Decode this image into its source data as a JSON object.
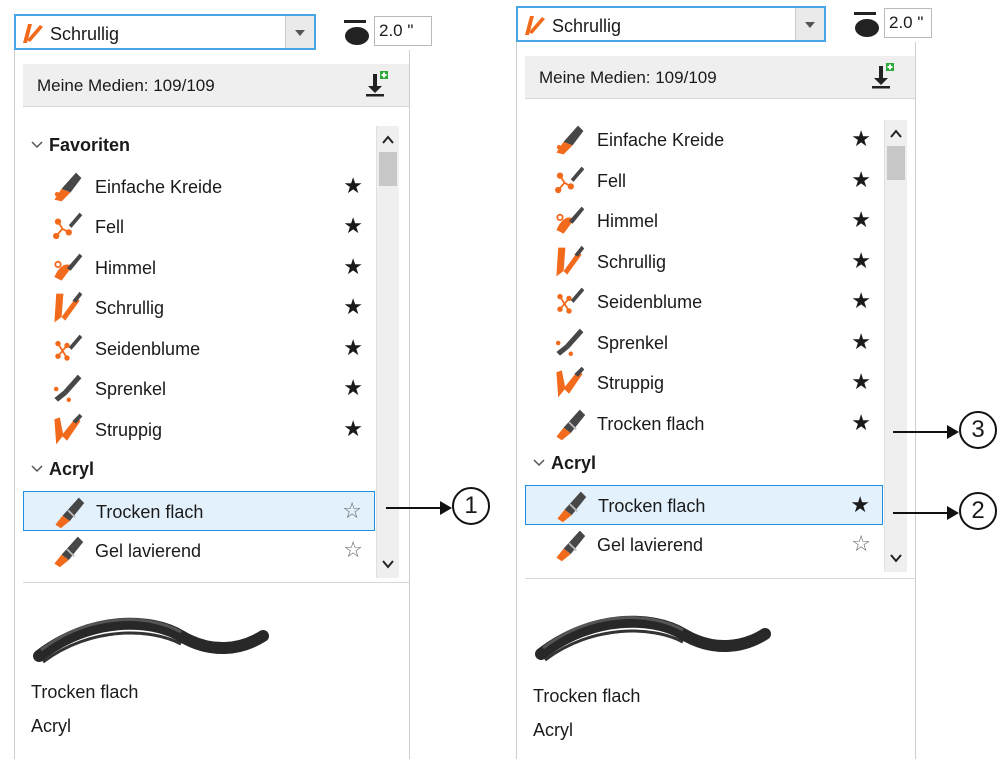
{
  "colors": {
    "accent_orange": "#f26a1b",
    "icon_dark": "#474747",
    "selection_border": "#1f8ee5",
    "selection_fill": "#e3f1fd"
  },
  "left_panel": {
    "preset": "Schrullig",
    "size_value": "2.0 \"",
    "media_header": "Meine Medien: 109/109",
    "sections": [
      {
        "type": "category",
        "label": "Favoriten"
      },
      {
        "type": "item",
        "label": "Einfache Kreide",
        "icon": "chalk-icon",
        "favorite": true
      },
      {
        "type": "item",
        "label": "Fell",
        "icon": "fur-icon",
        "favorite": true
      },
      {
        "type": "item",
        "label": "Himmel",
        "icon": "sky-icon",
        "favorite": true
      },
      {
        "type": "item",
        "label": "Schrullig",
        "icon": "quirky-icon",
        "favorite": true
      },
      {
        "type": "item",
        "label": "Seidenblume",
        "icon": "silkflower-icon",
        "favorite": true
      },
      {
        "type": "item",
        "label": "Sprenkel",
        "icon": "sprinkle-icon",
        "favorite": true
      },
      {
        "type": "item",
        "label": "Struppig",
        "icon": "shaggy-icon",
        "favorite": true
      },
      {
        "type": "category",
        "label": "Acryl"
      },
      {
        "type": "item",
        "label": "Trocken flach",
        "icon": "flat-brush-icon",
        "favorite": false,
        "selected": true
      },
      {
        "type": "item",
        "label": "Gel lavierend",
        "icon": "flat-brush-icon",
        "favorite": false
      }
    ],
    "preview_name": "Trocken flach",
    "preview_category": "Acryl",
    "callout": "1"
  },
  "right_panel": {
    "preset": "Schrullig",
    "size_value": "2.0 \"",
    "media_header": "Meine Medien: 109/109",
    "sections": [
      {
        "type": "item",
        "label": "Einfache Kreide",
        "icon": "chalk-icon",
        "favorite": true
      },
      {
        "type": "item",
        "label": "Fell",
        "icon": "fur-icon",
        "favorite": true
      },
      {
        "type": "item",
        "label": "Himmel",
        "icon": "sky-icon",
        "favorite": true
      },
      {
        "type": "item",
        "label": "Schrullig",
        "icon": "quirky-icon",
        "favorite": true
      },
      {
        "type": "item",
        "label": "Seidenblume",
        "icon": "silkflower-icon",
        "favorite": true
      },
      {
        "type": "item",
        "label": "Sprenkel",
        "icon": "sprinkle-icon",
        "favorite": true
      },
      {
        "type": "item",
        "label": "Struppig",
        "icon": "shaggy-icon",
        "favorite": true
      },
      {
        "type": "item",
        "label": "Trocken flach",
        "icon": "flat-brush-icon",
        "favorite": true
      },
      {
        "type": "category",
        "label": "Acryl"
      },
      {
        "type": "item",
        "label": "Trocken flach",
        "icon": "flat-brush-icon",
        "favorite": true,
        "selected": true
      },
      {
        "type": "item",
        "label": "Gel lavierend",
        "icon": "flat-brush-icon",
        "favorite": false
      }
    ],
    "preview_name": "Trocken flach",
    "preview_category": "Acryl",
    "callouts": [
      "3",
      "2"
    ]
  }
}
